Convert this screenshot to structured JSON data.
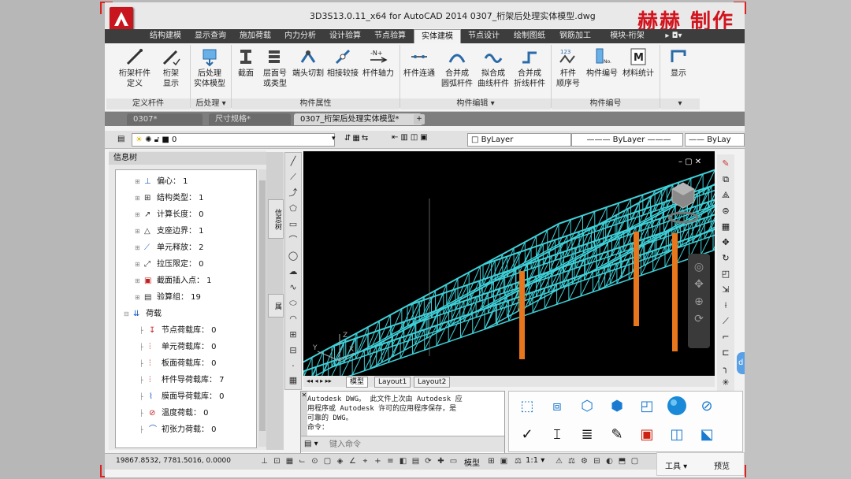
{
  "window": {
    "title": "3D3S13.0.11_x64 for AutoCAD 2014      0307_桁架后处理实体模型.dwg",
    "watermark": "赫赫  制作"
  },
  "ribbon_tabs": [
    "结构建模",
    "显示查询",
    "施加荷载",
    "内力分析",
    "设计验算",
    "节点验算",
    "实体建模",
    "节点设计",
    "绘制图纸",
    "钢筋加工",
    "模块-桁架"
  ],
  "active_tab": "实体建模",
  "ribbon": {
    "buttons": [
      {
        "label": "桁架杆件\n定义",
        "icon": "truss-member-icon"
      },
      {
        "label": "桁架\n显示",
        "icon": "truss-display-icon"
      },
      {
        "label": "后处理\n实体模型",
        "icon": "solid-model-icon"
      },
      {
        "label": "截面",
        "icon": "section-icon"
      },
      {
        "label": "层面号\n或类型",
        "icon": "layer-number-icon"
      },
      {
        "label": "端头切割",
        "icon": "end-cut-icon"
      },
      {
        "label": "相接较接",
        "icon": "hinge-connect-icon"
      },
      {
        "label": "杆件轴力",
        "icon": "axial-force-icon"
      },
      {
        "label": "杆件连通",
        "icon": "member-connect-icon"
      },
      {
        "label": "合并成\n圆弧杆件",
        "icon": "arc-merge-icon"
      },
      {
        "label": "拟合成\n曲线杆件",
        "icon": "curve-fit-icon"
      },
      {
        "label": "合并成\n折线杆件",
        "icon": "polyline-merge-icon"
      },
      {
        "label": "杆件\n顺序号",
        "icon": "member-order-icon"
      },
      {
        "label": "构件编号",
        "icon": "component-number-icon"
      },
      {
        "label": "材料统计",
        "icon": "material-stats-icon"
      },
      {
        "label": "显示",
        "icon": "display-icon"
      }
    ],
    "groups": [
      "定义杆件",
      "后处理 ▾",
      "构件属性",
      "构件编辑 ▾",
      "构件编号",
      "▾"
    ]
  },
  "doc_tabs": [
    "0307*",
    "尺寸规格*",
    "0307_桁架后处理实体模型*"
  ],
  "active_doc_tab": "0307_桁架后处理实体模型*",
  "layer_bar": {
    "layer_value": "0",
    "color_value": "ByLayer",
    "linetype_value": "ByLayer",
    "lineweight_value": "ByLay"
  },
  "info_panel": {
    "title": "信息树",
    "items": [
      {
        "text": "偏心：  1",
        "icon": "eccentric-icon",
        "level": 1
      },
      {
        "text": "结构类型：  1",
        "icon": "structure-type-icon",
        "level": 1
      },
      {
        "text": "计算长度：  0",
        "icon": "calc-length-icon",
        "level": 1
      },
      {
        "text": "支座边界：  1",
        "icon": "support-boundary-icon",
        "level": 1
      },
      {
        "text": "单元释放：  2",
        "icon": "element-release-icon",
        "level": 1
      },
      {
        "text": "拉压限定：  0",
        "icon": "tension-limit-icon",
        "level": 1
      },
      {
        "text": "截面插入点：  1",
        "icon": "section-insert-icon",
        "level": 1
      },
      {
        "text": "验算组：  19",
        "icon": "check-group-icon",
        "level": 1
      },
      {
        "text": "荷载",
        "icon": "load-icon",
        "level": 0
      },
      {
        "text": "节点荷载库：  0",
        "icon": "node-load-icon",
        "level": 2
      },
      {
        "text": "单元荷载库：  0",
        "icon": "element-load-icon",
        "level": 2
      },
      {
        "text": "板面荷载库：  0",
        "icon": "plate-load-icon",
        "level": 2
      },
      {
        "text": "杆件导荷载库：  7",
        "icon": "member-load-icon",
        "level": 2
      },
      {
        "text": "膜面导荷载库：  0",
        "icon": "membrane-load-icon",
        "level": 2
      },
      {
        "text": "温度荷载：  0",
        "icon": "temperature-load-icon",
        "level": 2
      },
      {
        "text": "初张力荷载：  0",
        "icon": "pretension-load-icon",
        "level": 2
      }
    ],
    "side_tabs": [
      "信息树",
      "属"
    ]
  },
  "layout_tabs": [
    "模型",
    "Layout1",
    "Layout2"
  ],
  "command_line": {
    "lines": [
      "Autodesk DWG。 此文件上次由 Autodesk 应",
      "用程序或 Autodesk 许可的应用程序保存，是",
      "可靠的 DWG。",
      "命令："
    ],
    "placeholder": "键入命令"
  },
  "status_bar": {
    "coordinates": "19867.8532,  7781.5016,  0.0000",
    "model_label": "模型",
    "scale": "1:1 ▾"
  },
  "palette": {
    "tools_label": "工具 ▾",
    "preview_label": "预览"
  },
  "colors": {
    "truss": "#3fd0d8",
    "column": "#e8761c",
    "viewport_bg": "#000000",
    "accent": "#c9151d"
  }
}
